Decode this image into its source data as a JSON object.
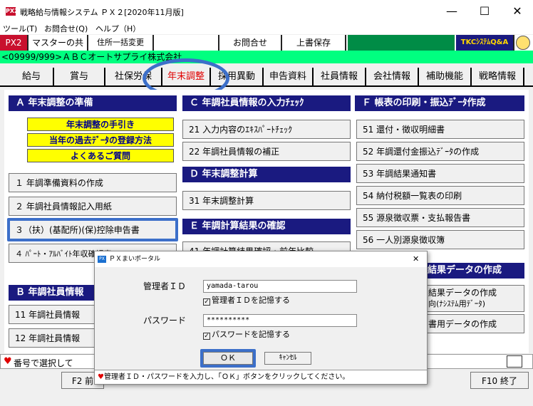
{
  "window": {
    "app_icon": "PX2",
    "title": "戦略給与情報システム ＰＸ２[2020年11月版]",
    "minimize": "—",
    "maximize": "☐",
    "close": "✕"
  },
  "menubar": {
    "tools": "ツール(T)",
    "inquiry": "お問合せ(Q)",
    "help": "ヘルプ（H）"
  },
  "toolbar": {
    "logo": "PX2",
    "master_share": "マスターの共有",
    "address_bulk": "住所一括変更",
    "contact": "お問合せ",
    "overwrite_save": "上書保存",
    "tkc_qa": "TKCｼｽﾃﾑQ&A"
  },
  "company": "<09999/999>ＡＢＣオートサプライ株式会社",
  "tabs": [
    "給与",
    "賞与",
    "社保労保",
    "年末調整",
    "採用異動",
    "申告資料",
    "社員情報",
    "会社情報",
    "補助機能",
    "戦略情報"
  ],
  "section_a": {
    "title": "Ａ 年末調整の準備",
    "yellow_buttons": [
      "年末調整の手引き",
      "当年の過去ﾃﾞｰﾀの登録方法",
      "よくあるご質問"
    ],
    "items": [
      "１ 年調準備資料の作成",
      "２ 年調社員情報記入用紙",
      "３（扶）(基配所)(保)控除申告書",
      "４ ﾊﾟｰﾄ・ｱﾙﾊﾞｲﾄ年収確認表"
    ]
  },
  "section_b": {
    "title": "Ｂ 年調社員情報",
    "items": [
      "11 年調社員情報",
      "12 年調社員情報"
    ]
  },
  "section_c": {
    "title": "Ｃ 年調社員情報の入力ﾁｪｯｸ",
    "items": [
      "21 入力内容のｴｷｽﾊﾟｰﾄﾁｪｯｸ",
      "22 年調社員情報の補正"
    ]
  },
  "section_d": {
    "title": "Ｄ 年末調整計算",
    "items": [
      "31 年末調整計算"
    ]
  },
  "section_e": {
    "title": "Ｅ 年調計算結果の確認",
    "items": [
      "41 年調計算結果確認・前年比較"
    ]
  },
  "section_f": {
    "title": "Ｆ 帳表の印刷・振込ﾃﾞｰﾀ作成",
    "items": [
      "51 還付・徴収明細書",
      "52 年調還付金振込ﾃﾞｰﾀの作成",
      "53 年調結果通知書",
      "54 納付税額一覧表の印刷",
      "55 源泉徴収票・支払報告書",
      "56 一人別源泉徴収簿"
    ]
  },
  "section_g": {
    "title": "結果データの作成",
    "items": [
      "結果データの作成",
      "向(ﾅｼｽﾃﾑ用ﾃﾞｰﾀ)",
      "書用データの作成"
    ]
  },
  "statusbar": {
    "text": "番号で選択して",
    "dialog_hint": "管理者ＩＤ・パスワードを入力し、「ＯＫ」ボタンをクリックしてください。"
  },
  "fkeys": {
    "f2": "F2 前",
    "f10": "F10 終了"
  },
  "dialog": {
    "icon": "PX",
    "title": "ＰＸまいポータル",
    "close": "✕",
    "admin_id_label": "管理者ＩＤ",
    "admin_id_value": "yamada-tarou",
    "remember_id": "管理者ＩＤを記憶する",
    "password_label": "パスワード",
    "password_value": "**********",
    "remember_password": "パスワードを記憶する",
    "ok": "ＯＫ",
    "cancel": "ｷｬﾝｾﾙ",
    "check_mark": "✓"
  },
  "colors": {
    "section_header": "#1a1a80",
    "company_bar": "#00ff80",
    "highlight": "#3c6fc9",
    "active_tab_text": "#e00000",
    "yellow_button": "#ffff00"
  }
}
